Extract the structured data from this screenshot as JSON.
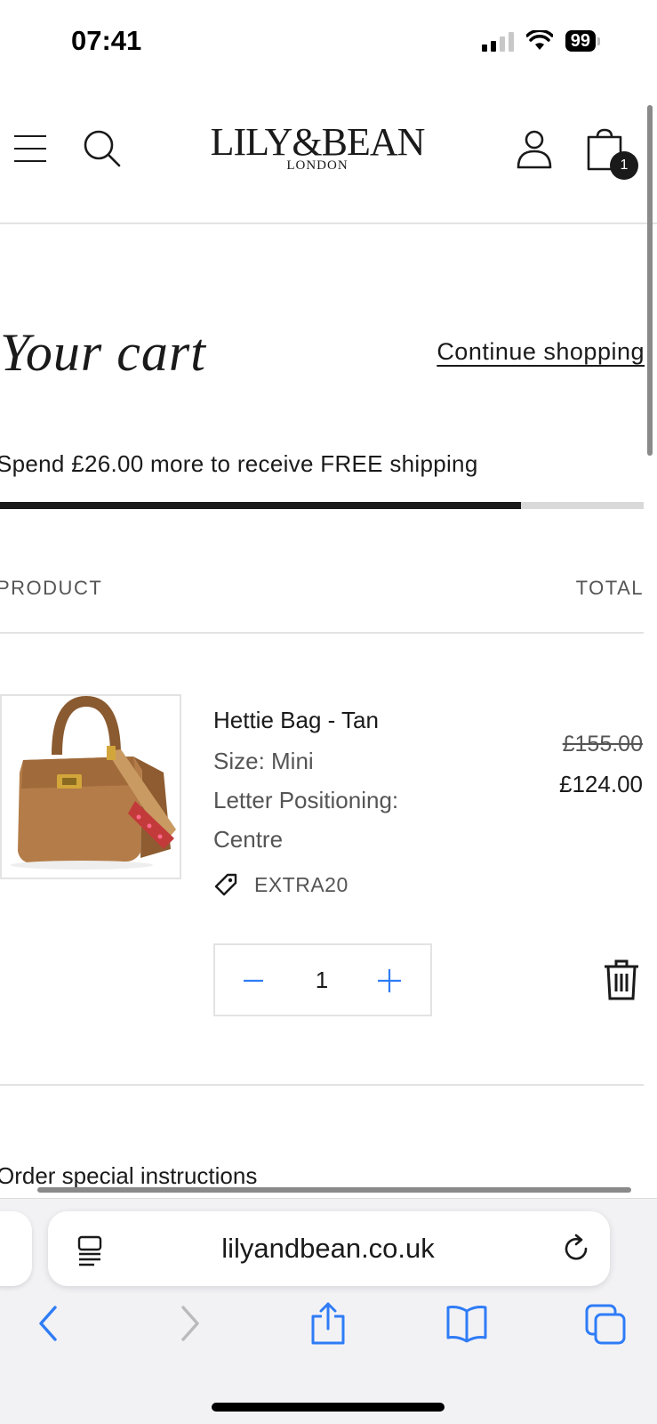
{
  "status_bar": {
    "time": "07:41",
    "battery": "99"
  },
  "header": {
    "logo_main": "LILY&BEAN",
    "logo_sub": "LONDON",
    "cart_count": "1"
  },
  "cart": {
    "title": "Your cart",
    "continue_label": "Continue shopping",
    "shipping_message": "Spend £26.00 more to receive FREE shipping",
    "shipping_progress": 0.81,
    "col_product": "PRODUCT",
    "col_total": "TOTAL",
    "item": {
      "name": "Hettie Bag - Tan",
      "size": "Size: Mini",
      "letter_positioning_label": "Letter Positioning:",
      "letter_positioning_value": "Centre",
      "discount_code": "EXTRA20",
      "price_original": "£155.00",
      "price_final": "£124.00",
      "quantity": "1"
    },
    "instructions_label": "Order special instructions"
  },
  "browser": {
    "url": "lilyandbean.co.uk"
  },
  "icons": {
    "menu": "hamburger-menu-icon",
    "search": "search-icon",
    "account": "user-icon",
    "cart": "shopping-bag-icon",
    "tag": "tag-icon",
    "minus": "minus-icon",
    "plus": "plus-icon",
    "delete": "trash-icon",
    "reader": "reader-mode-icon",
    "reload": "reload-icon",
    "back": "back-icon",
    "forward": "forward-icon",
    "share": "share-icon",
    "bookmarks": "bookmarks-icon",
    "tabs": "tabs-icon"
  },
  "colors": {
    "text": "#1a1a1a",
    "muted": "#555555",
    "border": "#e3e3e3",
    "progress_track": "#d9d9d9",
    "ios_blue": "#2f7cf6",
    "tan": "#b07a48"
  }
}
